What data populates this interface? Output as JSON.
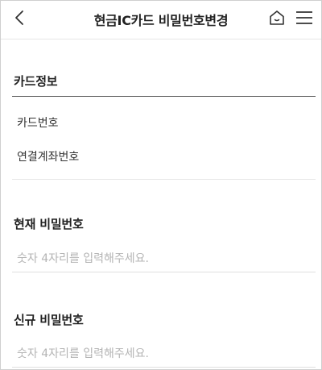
{
  "header": {
    "title": "현금IC카드 비밀번호변경",
    "back_icon": "chevron-left-icon",
    "home_icon": "home-icon",
    "menu_icon": "hamburger-menu-icon"
  },
  "card_info": {
    "title": "카드정보",
    "rows": [
      {
        "label": "카드번호"
      },
      {
        "label": "연결계좌번호"
      }
    ]
  },
  "current_password": {
    "title": "현재 비밀번호",
    "placeholder": "숫자 4자리를 입력해주세요."
  },
  "new_password": {
    "title": "신규 비밀번호",
    "placeholder": "숫자 4자리를 입력해주세요."
  }
}
